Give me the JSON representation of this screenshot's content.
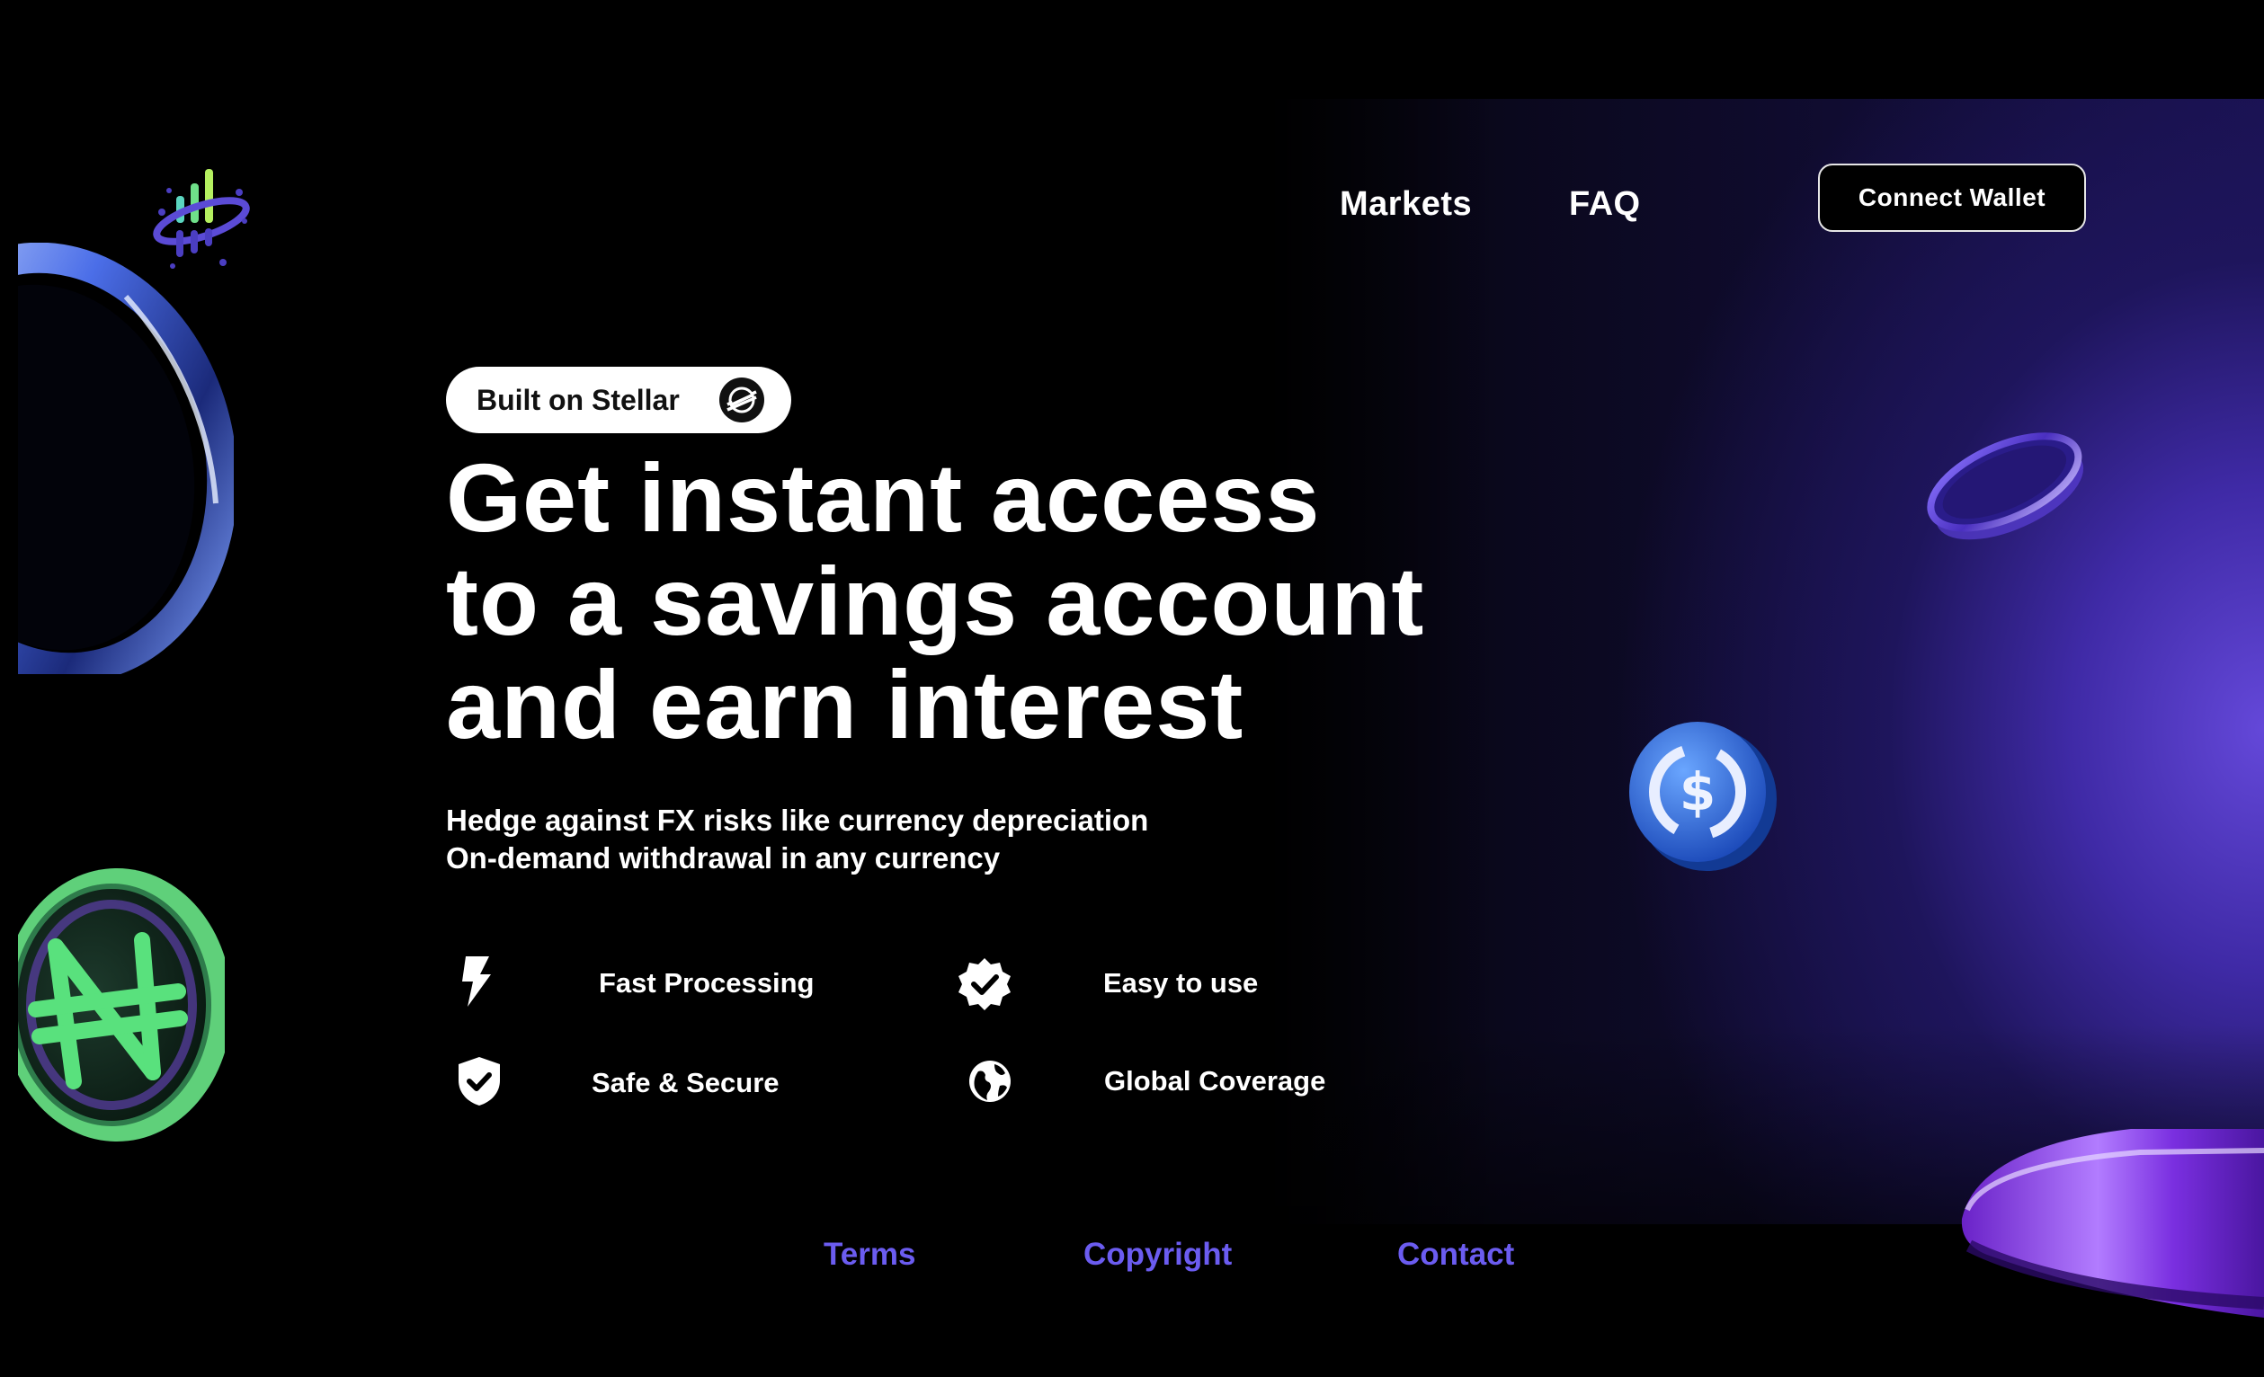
{
  "nav": {
    "items": [
      {
        "label": "Markets"
      },
      {
        "label": "FAQ"
      }
    ],
    "connect_wallet": "Connect Wallet"
  },
  "hero": {
    "badge": "Built on Stellar",
    "headline": [
      "Get instant access",
      "to a savings account",
      "and earn interest"
    ],
    "subtitle": [
      "Hedge against FX risks like currency depreciation",
      "On-demand withdrawal in any currency"
    ],
    "features": [
      {
        "label": "Fast Processing",
        "icon": "lightning-icon"
      },
      {
        "label": "Easy to use",
        "icon": "verified-badge-icon"
      },
      {
        "label": "Safe & Secure",
        "icon": "shield-check-icon"
      },
      {
        "label": "Global Coverage",
        "icon": "globe-icon"
      }
    ]
  },
  "footer": {
    "links": [
      {
        "label": "Terms"
      },
      {
        "label": "Copyright"
      },
      {
        "label": "Contact"
      }
    ]
  },
  "colors": {
    "background": "#000000",
    "accent": "#6b5cf0",
    "panel": "#4b33c2",
    "text": "#ffffff"
  }
}
